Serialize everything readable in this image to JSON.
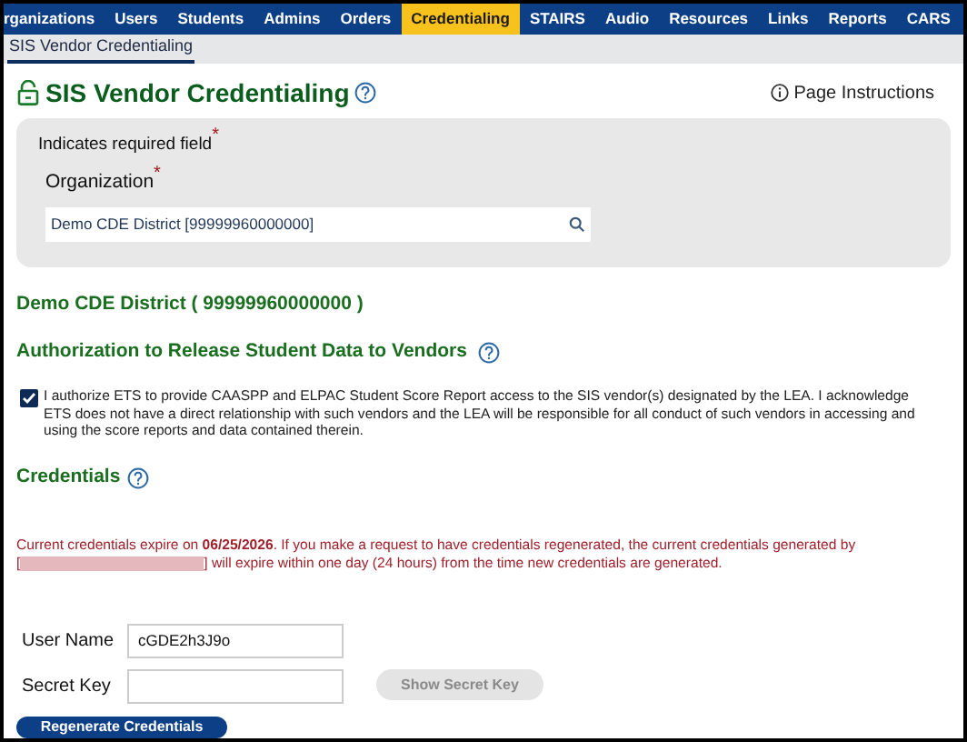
{
  "nav": {
    "tabs": [
      {
        "label": "rganizations",
        "selected": false
      },
      {
        "label": "Users",
        "selected": false
      },
      {
        "label": "Students",
        "selected": false
      },
      {
        "label": "Admins",
        "selected": false
      },
      {
        "label": "Orders",
        "selected": false
      },
      {
        "label": "Credentialing",
        "selected": true
      },
      {
        "label": "STAIRS",
        "selected": false
      },
      {
        "label": "Audio",
        "selected": false
      },
      {
        "label": "Resources",
        "selected": false
      },
      {
        "label": "Links",
        "selected": false
      },
      {
        "label": "Reports",
        "selected": false
      },
      {
        "label": "CARS",
        "selected": false
      }
    ]
  },
  "subnav": {
    "tabs": [
      {
        "label": "SIS Vendor Credentialing",
        "selected": true
      }
    ]
  },
  "page": {
    "title": "SIS Vendor Credentialing",
    "instructions_link": "Page Instructions"
  },
  "search_panel": {
    "required_note": "Indicates required field",
    "required_mark": "*",
    "organization_label": "Organization",
    "organization_mark": "*",
    "organization_value": "Demo CDE District [99999960000000]"
  },
  "org_heading": "Demo CDE District ( 99999960000000 )",
  "authorization": {
    "heading": "Authorization to Release Student Data to Vendors",
    "checked": true,
    "text": "I authorize ETS to provide CAASPP and ELPAC Student Score Report access to the SIS vendor(s) designated by the LEA. I acknowledge ETS does not have a direct relationship with such vendors and the LEA will be responsible for all conduct of such vendors in accessing and using the score reports and data contained therein."
  },
  "credentials": {
    "heading": "Credentials",
    "notice_line_1": "Current credentials expire on **06/25/2026**. If you make a request to have credentials regenerated, the current credentials generated by",
    "notice_open": "[",
    "notice_line_2": "] will expire within one day (24 hours) from the time new credentials are generated.",
    "user_name_label": "User Name",
    "user_name_value": "cGDE2h3J9o",
    "secret_key_label": "Secret Key",
    "show_secret_key_button": {
      "label": "Show Secret Key",
      "disabled": true
    },
    "regenerate_button": "Regenerate Credentials"
  }
}
